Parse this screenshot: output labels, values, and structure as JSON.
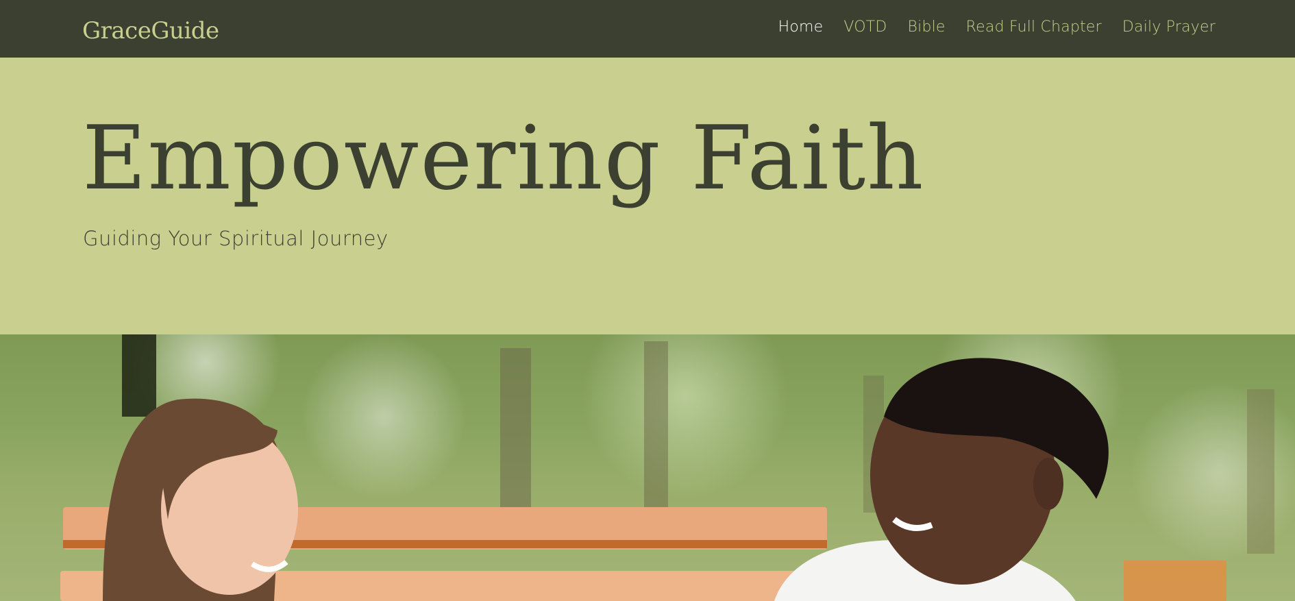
{
  "brand": "GraceGuide",
  "nav": {
    "items": [
      {
        "label": "Home",
        "active": true
      },
      {
        "label": "VOTD",
        "active": false
      },
      {
        "label": "Bible",
        "active": false
      },
      {
        "label": "Read Full Chapter",
        "active": false
      },
      {
        "label": "Daily Prayer",
        "active": false
      }
    ]
  },
  "hero": {
    "title": "Empowering Faith",
    "subtitle": "Guiding Your Spiritual Journey"
  },
  "colors": {
    "nav_bg": "#3b4030",
    "accent": "#c9cf8f",
    "text_dark": "#3b4030",
    "active_link": "#ffffff"
  }
}
